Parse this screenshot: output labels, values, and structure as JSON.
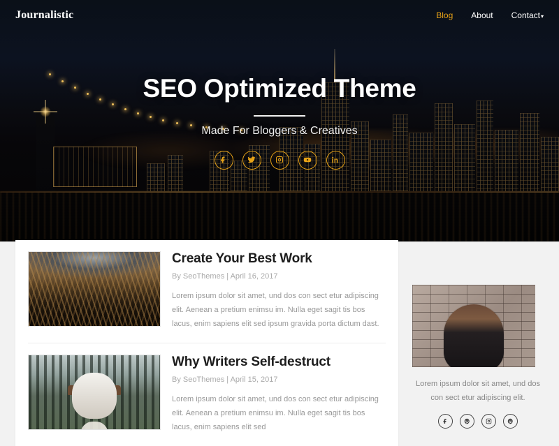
{
  "site": {
    "logo": "Journalistic",
    "accent_color": "#e8a317",
    "nav_bg": "#0a0f18",
    "page_bg": "#f2f2f2"
  },
  "nav": {
    "items": [
      {
        "label": "Blog",
        "active": true,
        "icon": ""
      },
      {
        "label": "About",
        "active": false,
        "icon": ""
      },
      {
        "label": "Contact",
        "active": false,
        "icon": "chevron-down-icon"
      }
    ],
    "caret": "▾"
  },
  "hero": {
    "title": "SEO Optimized Theme",
    "subtitle": "Made For Bloggers & Creatives",
    "background": "night city skyline with bridge and water reflection",
    "socials": [
      {
        "name": "facebook-icon",
        "label": "f"
      },
      {
        "name": "twitter-icon",
        "label": "t"
      },
      {
        "name": "instagram-icon",
        "label": "ig"
      },
      {
        "name": "youtube-icon",
        "label": "yt"
      },
      {
        "name": "linkedin-icon",
        "label": "in"
      }
    ]
  },
  "posts": [
    {
      "title": "Create Your Best Work",
      "meta": "By SeoThemes | April 16, 2017",
      "author": "SeoThemes",
      "date": "April 16, 2017",
      "excerpt": "Lorem ipsum dolor sit amet, und dos con sect etur adipiscing elit. Aenean a pretium enimsu im. Nulla eget sagit tis bos lacus, enim sapiens elit sed ipsum gravida porta dictum dast.",
      "thumb": "golden grass field with mountains"
    },
    {
      "title": "Why Writers Self-destruct",
      "meta": "By SeoThemes | April 15, 2017",
      "author": "SeoThemes",
      "date": "April 15, 2017",
      "excerpt": "Lorem ipsum dolor sit amet, und dos con sect etur adipiscing elit. Aenean a pretium enimsu im. Nulla eget sagit tis bos lacus, enim sapiens elit sed",
      "thumb": "person holding bull skull in forest"
    }
  ],
  "sidebar": {
    "image_alt": "portrait of woman against brick wall",
    "text": "Lorem ipsum dolor sit amet, und dos con sect etur adipiscing elit.",
    "socials": [
      {
        "name": "facebook-icon",
        "label": "f"
      },
      {
        "name": "pinterest-icon",
        "label": "p"
      },
      {
        "name": "instagram-icon",
        "label": "ig"
      },
      {
        "name": "pinterest-icon",
        "label": "p"
      }
    ]
  }
}
